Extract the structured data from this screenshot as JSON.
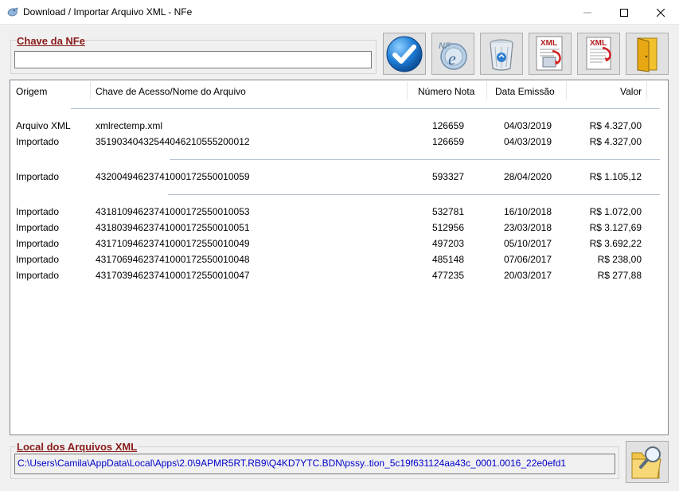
{
  "window": {
    "title": "Download / Importar Arquivo XML - NFe",
    "min_glyph": "—",
    "max_glyph": "☐",
    "close_glyph": "✕"
  },
  "chave": {
    "label": "Chave da NFe",
    "value": ""
  },
  "toolbar": {
    "buttons": [
      {
        "icon": "check-icon"
      },
      {
        "icon": "nfe-icon"
      },
      {
        "icon": "recycle-bin-icon"
      },
      {
        "icon": "xml-import-icon",
        "text": "XML"
      },
      {
        "icon": "xml-document-icon",
        "text": "XML"
      },
      {
        "icon": "exit-door-icon"
      }
    ]
  },
  "list": {
    "columns": [
      "Origem",
      "Chave de Acesso/Nome do Arquivo",
      "Número Nota",
      "Data Emissão",
      "Valor"
    ],
    "groups": [
      {
        "rows": [
          {
            "origem": "Arquivo XML",
            "chave": "xmlrectemp.xml",
            "numero": "126659",
            "data": "04/03/2019",
            "valor": "R$ 4.327,00"
          },
          {
            "origem": "Importado",
            "chave": "35190340432544046210555200012",
            "numero": "126659",
            "data": "04/03/2019",
            "valor": "R$ 4.327,00"
          }
        ]
      },
      {
        "rows": [
          {
            "origem": "Importado",
            "chave": "43200494623741000172550010059",
            "numero": "593327",
            "data": "28/04/2020",
            "valor": "R$ 1.105,12"
          }
        ]
      },
      {
        "rows": [
          {
            "origem": "Importado",
            "chave": "43181094623741000172550010053",
            "numero": "532781",
            "data": "16/10/2018",
            "valor": "R$ 1.072,00"
          },
          {
            "origem": "Importado",
            "chave": "43180394623741000172550010051",
            "numero": "512956",
            "data": "23/03/2018",
            "valor": "R$ 3.127,69"
          },
          {
            "origem": "Importado",
            "chave": "43171094623741000172550010049",
            "numero": "497203",
            "data": "05/10/2017",
            "valor": "R$ 3.692,22"
          },
          {
            "origem": "Importado",
            "chave": "43170694623741000172550010048",
            "numero": "485148",
            "data": "07/06/2017",
            "valor": "R$ 238,00"
          },
          {
            "origem": "Importado",
            "chave": "43170394623741000172550010047",
            "numero": "477235",
            "data": "20/03/2017",
            "valor": "R$ 277,88"
          }
        ]
      }
    ]
  },
  "local": {
    "label": "Local dos Arquivos XML",
    "path": "C:\\Users\\Camila\\AppData\\Local\\Apps\\2.0\\9APMR5RT.RB9\\Q4KD7YTC.BDN\\pssy..tion_5c19f631124aa43c_0001.0016_22e0efd1"
  },
  "colors": {
    "accent_label": "#8b1a1a",
    "path_text": "#0000cc",
    "group_separator": "#b8c3d3"
  }
}
